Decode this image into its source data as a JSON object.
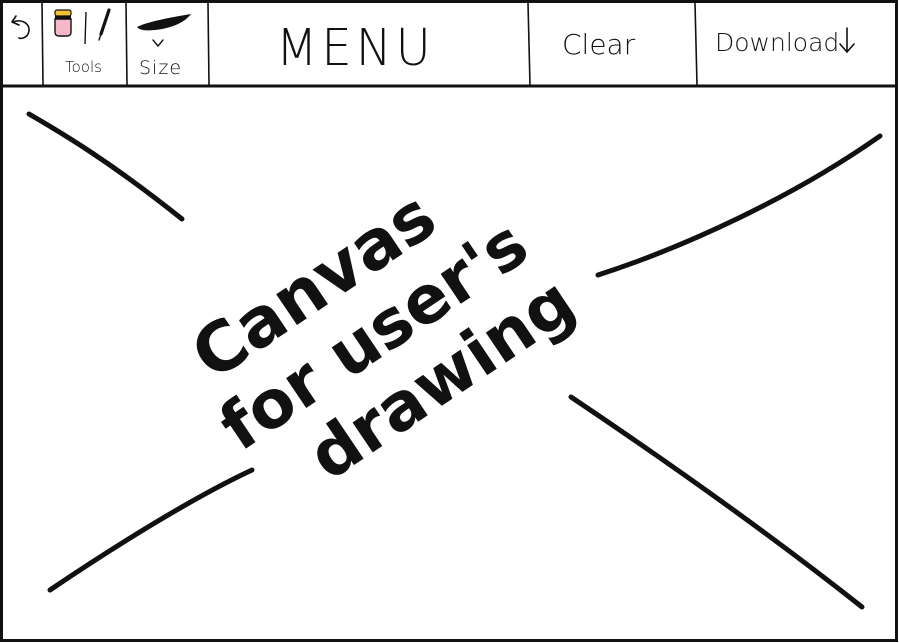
{
  "toolbar": {
    "undo_icon": "undo-arrow-icon",
    "tools_label": "Tools",
    "tools_icons": [
      "eraser-icon",
      "pen-icon"
    ],
    "size_label": "Size",
    "size_icons": [
      "brush-size-stroke-icon",
      "chevron-down-icon"
    ],
    "menu_label": "MENU",
    "clear_label": "Clear",
    "download_label": "Download",
    "download_icon": "down-arrow-icon"
  },
  "canvas": {
    "lines": [
      "Canvas",
      "for user's",
      "drawing"
    ]
  },
  "colors": {
    "ink": "#111111",
    "eraser_top": "#f2c233",
    "eraser_body": "#f4b8c8"
  }
}
